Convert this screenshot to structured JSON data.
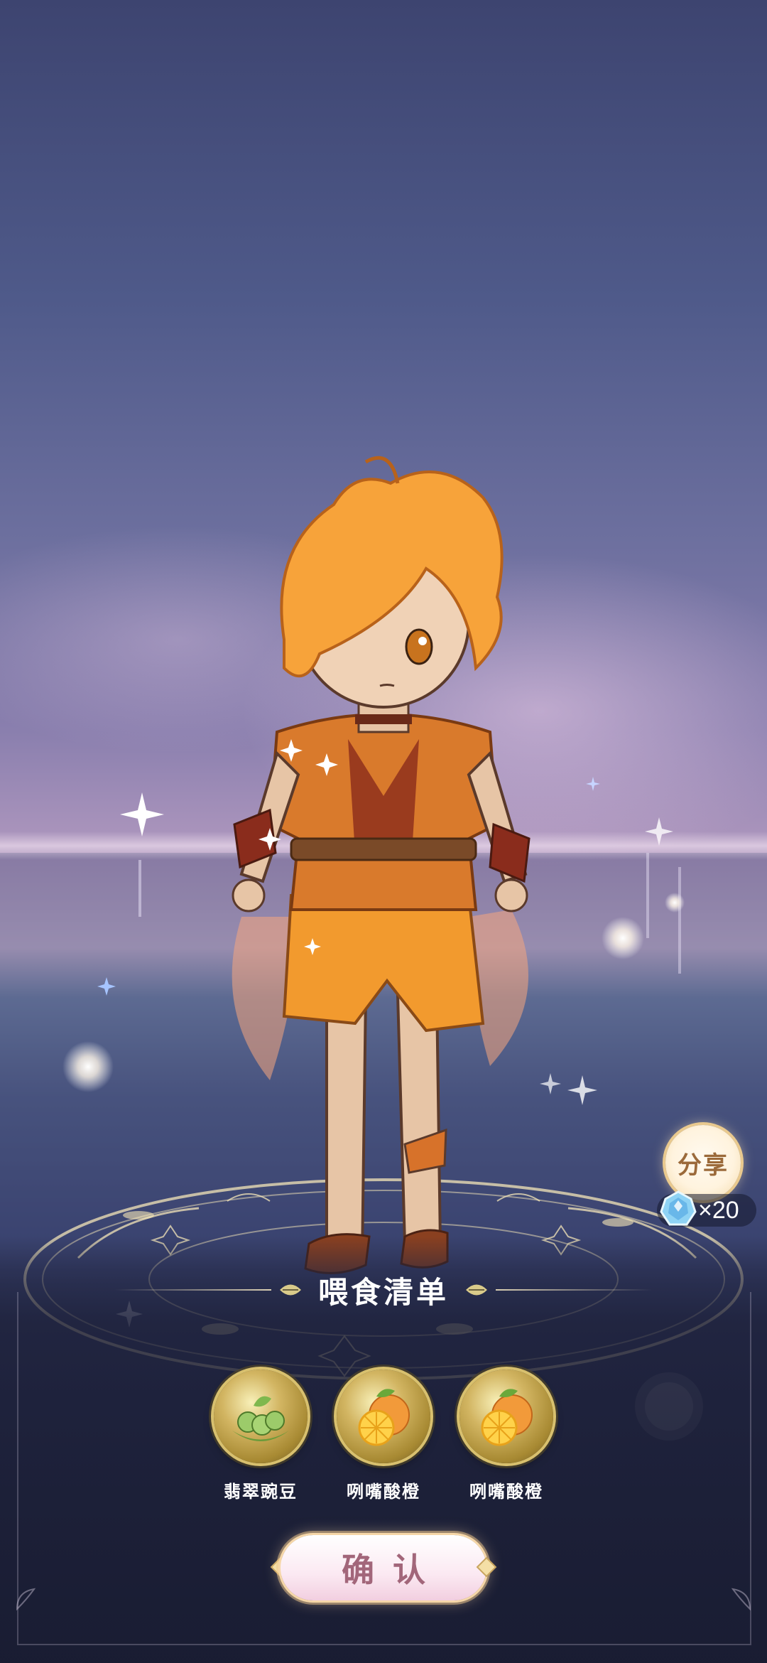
{
  "share": {
    "label": "分享",
    "reward_icon": "gem-icon",
    "reward_count": "×20"
  },
  "feeding_list": {
    "title": "喂食清单",
    "items": [
      {
        "name": "翡翠豌豆",
        "icon": "green-pea-icon"
      },
      {
        "name": "咧嘴酸橙",
        "icon": "orange-icon"
      },
      {
        "name": "咧嘴酸橙",
        "icon": "orange-icon"
      }
    ]
  },
  "confirm": {
    "label": "确认"
  },
  "colors": {
    "accent_gold": "#d8c06e",
    "confirm_text": "#a2667a",
    "share_text": "#9b6a3a",
    "panel_bg": "#1c1f37"
  }
}
